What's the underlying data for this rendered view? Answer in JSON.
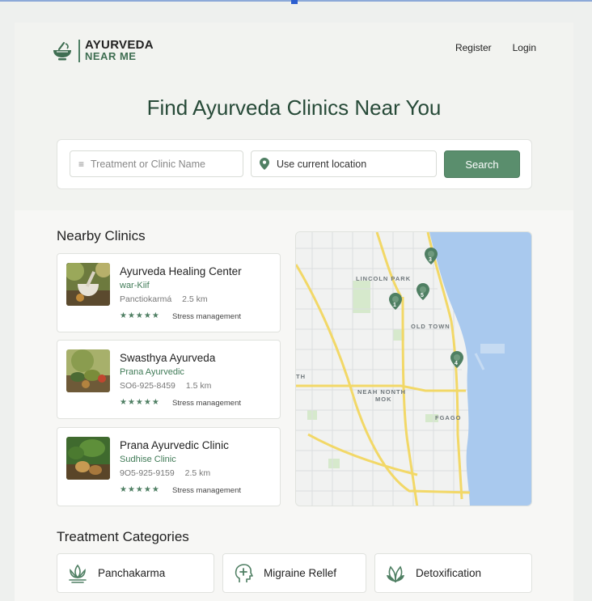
{
  "brand": {
    "line1": "AYURVEDA",
    "line2": "NEAR ME",
    "icon": "mortar-bowl-icon"
  },
  "nav": {
    "register": "Register",
    "login": "Login"
  },
  "hero": {
    "title": "Find Ayurveda Clinics Near You"
  },
  "search": {
    "name_placeholder": "Treatment or Clinic Name",
    "location_value": "Use current location",
    "button_label": "Search"
  },
  "nearby": {
    "title": "Nearby Clinics",
    "clinics": [
      {
        "name": "Ayurveda Healing Center",
        "subtitle": "war-Kiif",
        "detail": "Panctiokarmá",
        "distance": "2.5 km",
        "rating": "★★★★★",
        "tag": "Stress management"
      },
      {
        "name": "Swasthya Ayurveda",
        "subtitle": "Prana Ayurvedic",
        "detail": "SO6-925-8459",
        "distance": "1.5 km",
        "rating": "★★★★★",
        "tag": "Stress management"
      },
      {
        "name": "Prana Ayurvedic Clinic",
        "subtitle": "Sudhise Clinic",
        "detail": "9O5-925-9159",
        "distance": "2.5 km",
        "rating": "★★★★★",
        "tag": "Stress management"
      }
    ]
  },
  "map": {
    "labels": [
      "LINCOLN PARK",
      "OLD TOWN",
      "NEAH NONTH",
      "MOK",
      "FGAGO",
      "TH"
    ],
    "markers": [
      "3",
      "5",
      "1",
      "4"
    ]
  },
  "categories": {
    "title": "Treatment Categories",
    "items": [
      {
        "label": "Panchakarma",
        "icon": "lotus-icon"
      },
      {
        "label": "Migraine Rellef",
        "icon": "head-plus-icon"
      },
      {
        "label": "Detoxification",
        "icon": "leaf-icon"
      }
    ]
  },
  "colors": {
    "accent": "#5a8e6d",
    "title": "#274a38",
    "water": "#a9c9ee",
    "road": "#f2d867"
  }
}
